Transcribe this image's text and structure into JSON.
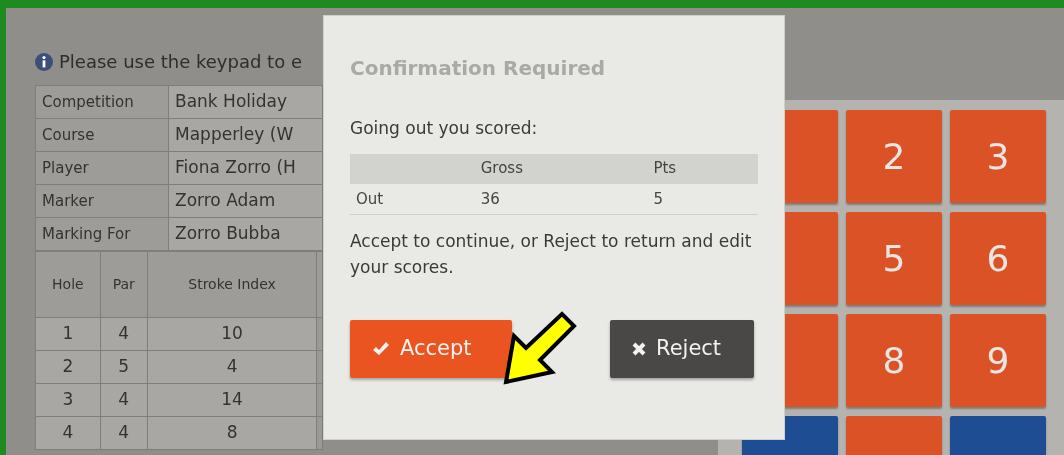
{
  "info_message": "Please use the keypad to e",
  "details": [
    {
      "label": "Competition",
      "value": "Bank Holiday"
    },
    {
      "label": "Course",
      "value": "Mapperley (W"
    },
    {
      "label": "Player",
      "value": "Fiona Zorro (H"
    },
    {
      "label": "Marker",
      "value": "Zorro Adam"
    },
    {
      "label": "Marking For",
      "value": "Zorro Bubba"
    }
  ],
  "holes_table": {
    "columns": [
      "Hole",
      "Par",
      "Stroke Index"
    ],
    "rows": [
      [
        "1",
        "4",
        "10"
      ],
      [
        "2",
        "5",
        "4"
      ],
      [
        "3",
        "4",
        "14"
      ],
      [
        "4",
        "4",
        "8"
      ]
    ]
  },
  "keypad": {
    "keys": [
      {
        "kind": "digit"
      },
      {
        "kind": "digit",
        "label": "2"
      },
      {
        "kind": "digit",
        "label": "3"
      },
      {
        "kind": "digit"
      },
      {
        "kind": "digit",
        "label": "5"
      },
      {
        "kind": "digit",
        "label": "6"
      },
      {
        "kind": "digit"
      },
      {
        "kind": "digit",
        "label": "8"
      },
      {
        "kind": "digit",
        "label": "9"
      },
      {
        "kind": "action"
      },
      {
        "kind": "digit"
      },
      {
        "kind": "action"
      }
    ]
  },
  "dialog": {
    "title": "Confirmation Required",
    "intro": "Going out you scored:",
    "summary": {
      "columns": [
        "Gross",
        "Pts"
      ],
      "rows": [
        {
          "label": "Out",
          "gross": "36",
          "pts": "5"
        }
      ]
    },
    "message": "Accept to continue, or Reject to return and edit your scores.",
    "buttons": [
      {
        "label": "Accept",
        "kind": "accept"
      },
      {
        "label": "Reject",
        "kind": "reject"
      }
    ]
  }
}
